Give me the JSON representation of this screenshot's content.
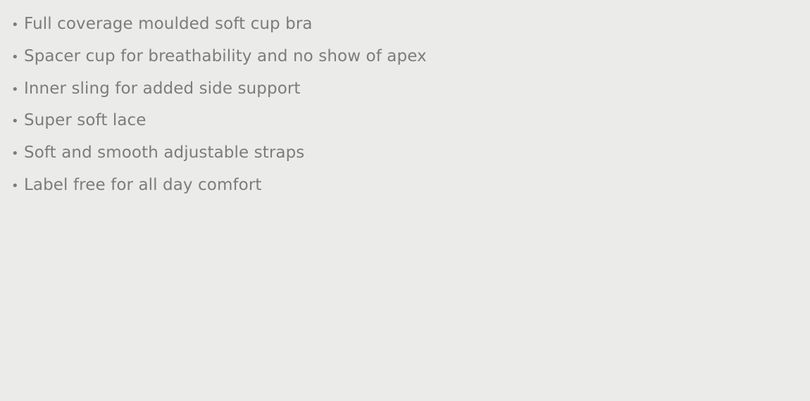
{
  "product_features": {
    "bullet_glyph": "•",
    "items": [
      "Full coverage moulded soft cup bra",
      "Spacer cup for breathability and no show of apex",
      "Inner sling for added side support",
      "Super soft lace",
      "Soft and smooth adjustable straps",
      "Label free for all day comfort"
    ]
  },
  "colors": {
    "background": "#ebebea",
    "text": "#7c7c7c"
  }
}
